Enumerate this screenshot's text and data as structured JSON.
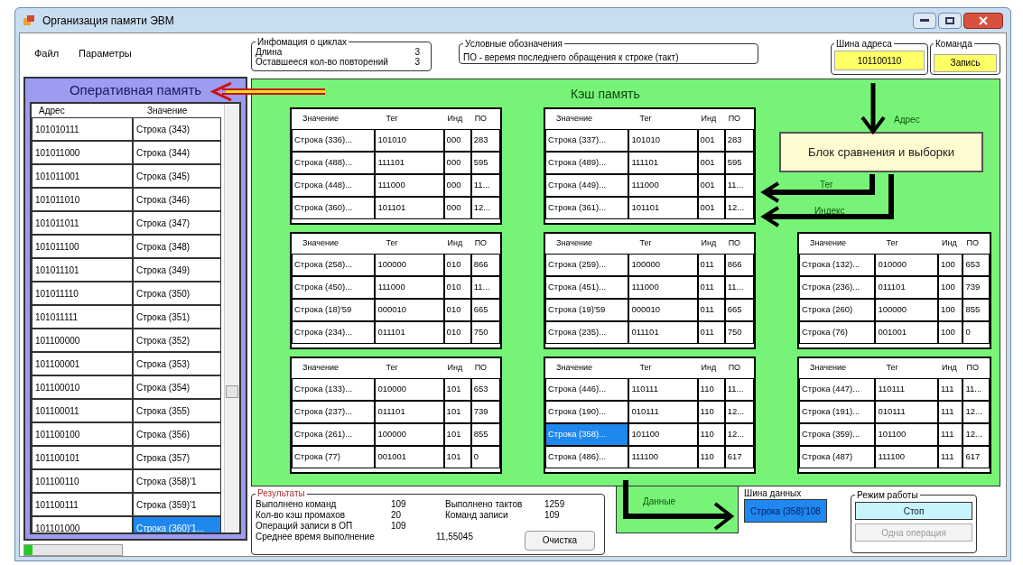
{
  "window": {
    "title": "Организация памяти ЭВМ"
  },
  "menu": [
    "Файл",
    "Параметры"
  ],
  "cycle_info": {
    "title": "Инфомация о циклах",
    "rows": [
      {
        "label": "Длина",
        "value": "3"
      },
      {
        "label": "Оставшееся кол-во повторений",
        "value": "3"
      }
    ]
  },
  "legend": {
    "title": "Условные обозначения",
    "text": "ПО - веремя последнего обращения к строке (такт)"
  },
  "address_bus": {
    "label": "Шина адреса",
    "value": "101100110"
  },
  "command": {
    "label": "Команда",
    "button": "Запись"
  },
  "ram": {
    "title": "Оперативная память",
    "columns": [
      "Адрес",
      "Значение"
    ],
    "rows": [
      {
        "address": "101010111",
        "value": "Строка (343)",
        "selected": false
      },
      {
        "address": "101011000",
        "value": "Строка (344)",
        "selected": false
      },
      {
        "address": "101011001",
        "value": "Строка (345)",
        "selected": false
      },
      {
        "address": "101011010",
        "value": "Строка (346)",
        "selected": false
      },
      {
        "address": "101011011",
        "value": "Строка (347)",
        "selected": false
      },
      {
        "address": "101011100",
        "value": "Строка (348)",
        "selected": false
      },
      {
        "address": "101011101",
        "value": "Строка (349)",
        "selected": false
      },
      {
        "address": "101011110",
        "value": "Строка (350)",
        "selected": false
      },
      {
        "address": "101011111",
        "value": "Строка (351)",
        "selected": false
      },
      {
        "address": "101100000",
        "value": "Строка (352)",
        "selected": false
      },
      {
        "address": "101100001",
        "value": "Строка (353)",
        "selected": false
      },
      {
        "address": "101100010",
        "value": "Строка (354)",
        "selected": false
      },
      {
        "address": "101100011",
        "value": "Строка (355)",
        "selected": false
      },
      {
        "address": "101100100",
        "value": "Строка (356)",
        "selected": false
      },
      {
        "address": "101100101",
        "value": "Строка (357)",
        "selected": false
      },
      {
        "address": "101100110",
        "value": "Строка (358)'1",
        "selected": false
      },
      {
        "address": "101100111",
        "value": "Строка (359)'1",
        "selected": false
      },
      {
        "address": "101101000",
        "value": "Строка (360)'1...",
        "selected": true
      }
    ]
  },
  "progress": {
    "level": 0.08
  },
  "cache": {
    "title": "Кэш память",
    "comparator": "Блок сравнения и выборки",
    "arrow_labels": {
      "address": "Адрес",
      "tag": "Тег",
      "index": "Индекс",
      "data": "Данные"
    },
    "tables": [
      {
        "columns": [
          "Значение",
          "Тег",
          "Инд",
          "ПО"
        ],
        "rows": [
          {
            "value": "Строка (336)...",
            "tag": "101010",
            "index": "000",
            "lru": "283",
            "selected": false
          },
          {
            "value": "Строка (488)...",
            "tag": "111101",
            "index": "000",
            "lru": "595",
            "selected": false
          },
          {
            "value": "Строка (448)...",
            "tag": "111000",
            "index": "000",
            "lru": "11...",
            "selected": false
          },
          {
            "value": "Строка (360)...",
            "tag": "101101",
            "index": "000",
            "lru": "12...",
            "selected": false
          }
        ]
      },
      {
        "columns": [
          "Значение",
          "Тег",
          "Инд",
          "ПО"
        ],
        "rows": [
          {
            "value": "Строка (337)...",
            "tag": "101010",
            "index": "001",
            "lru": "283",
            "selected": false
          },
          {
            "value": "Строка (489)...",
            "tag": "111101",
            "index": "001",
            "lru": "595",
            "selected": false
          },
          {
            "value": "Строка (449)...",
            "tag": "111000",
            "index": "001",
            "lru": "11...",
            "selected": false
          },
          {
            "value": "Строка (361)...",
            "tag": "101101",
            "index": "001",
            "lru": "12...",
            "selected": false
          }
        ]
      },
      {
        "columns": [
          "Значение",
          "Тег",
          "Инд",
          "ПО"
        ],
        "rows": [
          {
            "value": "Строка (258)...",
            "tag": "100000",
            "index": "010",
            "lru": "866",
            "selected": false
          },
          {
            "value": "Строка (450)...",
            "tag": "111000",
            "index": "010",
            "lru": "11...",
            "selected": false
          },
          {
            "value": "Строка (18)'59",
            "tag": "000010",
            "index": "010",
            "lru": "665",
            "selected": false
          },
          {
            "value": "Строка (234)...",
            "tag": "011101",
            "index": "010",
            "lru": "750",
            "selected": false
          }
        ]
      },
      {
        "columns": [
          "Значение",
          "Тег",
          "Инд",
          "ПО"
        ],
        "rows": [
          {
            "value": "Строка (259)...",
            "tag": "100000",
            "index": "011",
            "lru": "866",
            "selected": false
          },
          {
            "value": "Строка (451)...",
            "tag": "111000",
            "index": "011",
            "lru": "11...",
            "selected": false
          },
          {
            "value": "Строка (19)'59",
            "tag": "000010",
            "index": "011",
            "lru": "665",
            "selected": false
          },
          {
            "value": "Строка (235)...",
            "tag": "011101",
            "index": "011",
            "lru": "750",
            "selected": false
          }
        ]
      },
      {
        "columns": [
          "Значение",
          "Тег",
          "Инд",
          "ПО"
        ],
        "rows": [
          {
            "value": "Строка (132)...",
            "tag": "010000",
            "index": "100",
            "lru": "653",
            "selected": false
          },
          {
            "value": "Строка (236)...",
            "tag": "011101",
            "index": "100",
            "lru": "739",
            "selected": false
          },
          {
            "value": "Строка (260)",
            "tag": "100000",
            "index": "100",
            "lru": "855",
            "selected": false
          },
          {
            "value": "Строка (76)",
            "tag": "001001",
            "index": "100",
            "lru": "0",
            "selected": false
          }
        ]
      },
      {
        "columns": [
          "Значение",
          "Тег",
          "Инд",
          "ПО"
        ],
        "rows": [
          {
            "value": "Строка (133)...",
            "tag": "010000",
            "index": "101",
            "lru": "653",
            "selected": false
          },
          {
            "value": "Строка (237)...",
            "tag": "011101",
            "index": "101",
            "lru": "739",
            "selected": false
          },
          {
            "value": "Строка (261)...",
            "tag": "100000",
            "index": "101",
            "lru": "855",
            "selected": false
          },
          {
            "value": "Строка (77)",
            "tag": "001001",
            "index": "101",
            "lru": "0",
            "selected": false
          }
        ]
      },
      {
        "columns": [
          "Значение",
          "Тег",
          "Инд",
          "ПО"
        ],
        "rows": [
          {
            "value": "Строка (446)...",
            "tag": "110111",
            "index": "110",
            "lru": "11...",
            "selected": false
          },
          {
            "value": "Строка (190)...",
            "tag": "010111",
            "index": "110",
            "lru": "12...",
            "selected": false
          },
          {
            "value": "Строка (358)...",
            "tag": "101100",
            "index": "110",
            "lru": "12...",
            "selected": true
          },
          {
            "value": "Строка (486)...",
            "tag": "111100",
            "index": "110",
            "lru": "617",
            "selected": false
          }
        ]
      },
      {
        "columns": [
          "Значение",
          "Тег",
          "Инд",
          "ПО"
        ],
        "rows": [
          {
            "value": "Строка (447)...",
            "tag": "110111",
            "index": "111",
            "lru": "11...",
            "selected": false
          },
          {
            "value": "Строка (191)...",
            "tag": "010111",
            "index": "111",
            "lru": "12...",
            "selected": false
          },
          {
            "value": "Строка (359)...",
            "tag": "101100",
            "index": "111",
            "lru": "12...",
            "selected": false
          },
          {
            "value": "Строка (487)",
            "tag": "111100",
            "index": "111",
            "lru": "617",
            "selected": false
          }
        ]
      }
    ]
  },
  "results": {
    "title": "Результаты",
    "left": [
      {
        "label": "Выполнено команд",
        "value": "109"
      },
      {
        "label": "Кол-во кэш промахов",
        "value": "20"
      },
      {
        "label": "Операций записи в ОП",
        "value": "109"
      }
    ],
    "right": [
      {
        "label": "Выполнено тактов",
        "value": "1259"
      },
      {
        "label": "Команд записи",
        "value": "109"
      }
    ],
    "average": {
      "label": "Среднее время выполнение",
      "value": "11,55045"
    },
    "clear_button": "Очистка"
  },
  "data_bus": {
    "label": "Шина данных",
    "value": "Строка (358)'108"
  },
  "mode": {
    "title": "Режим работы",
    "buttons": [
      {
        "label": "Стоп",
        "disabled": false
      },
      {
        "label": "Одна операция",
        "disabled": true
      }
    ]
  }
}
